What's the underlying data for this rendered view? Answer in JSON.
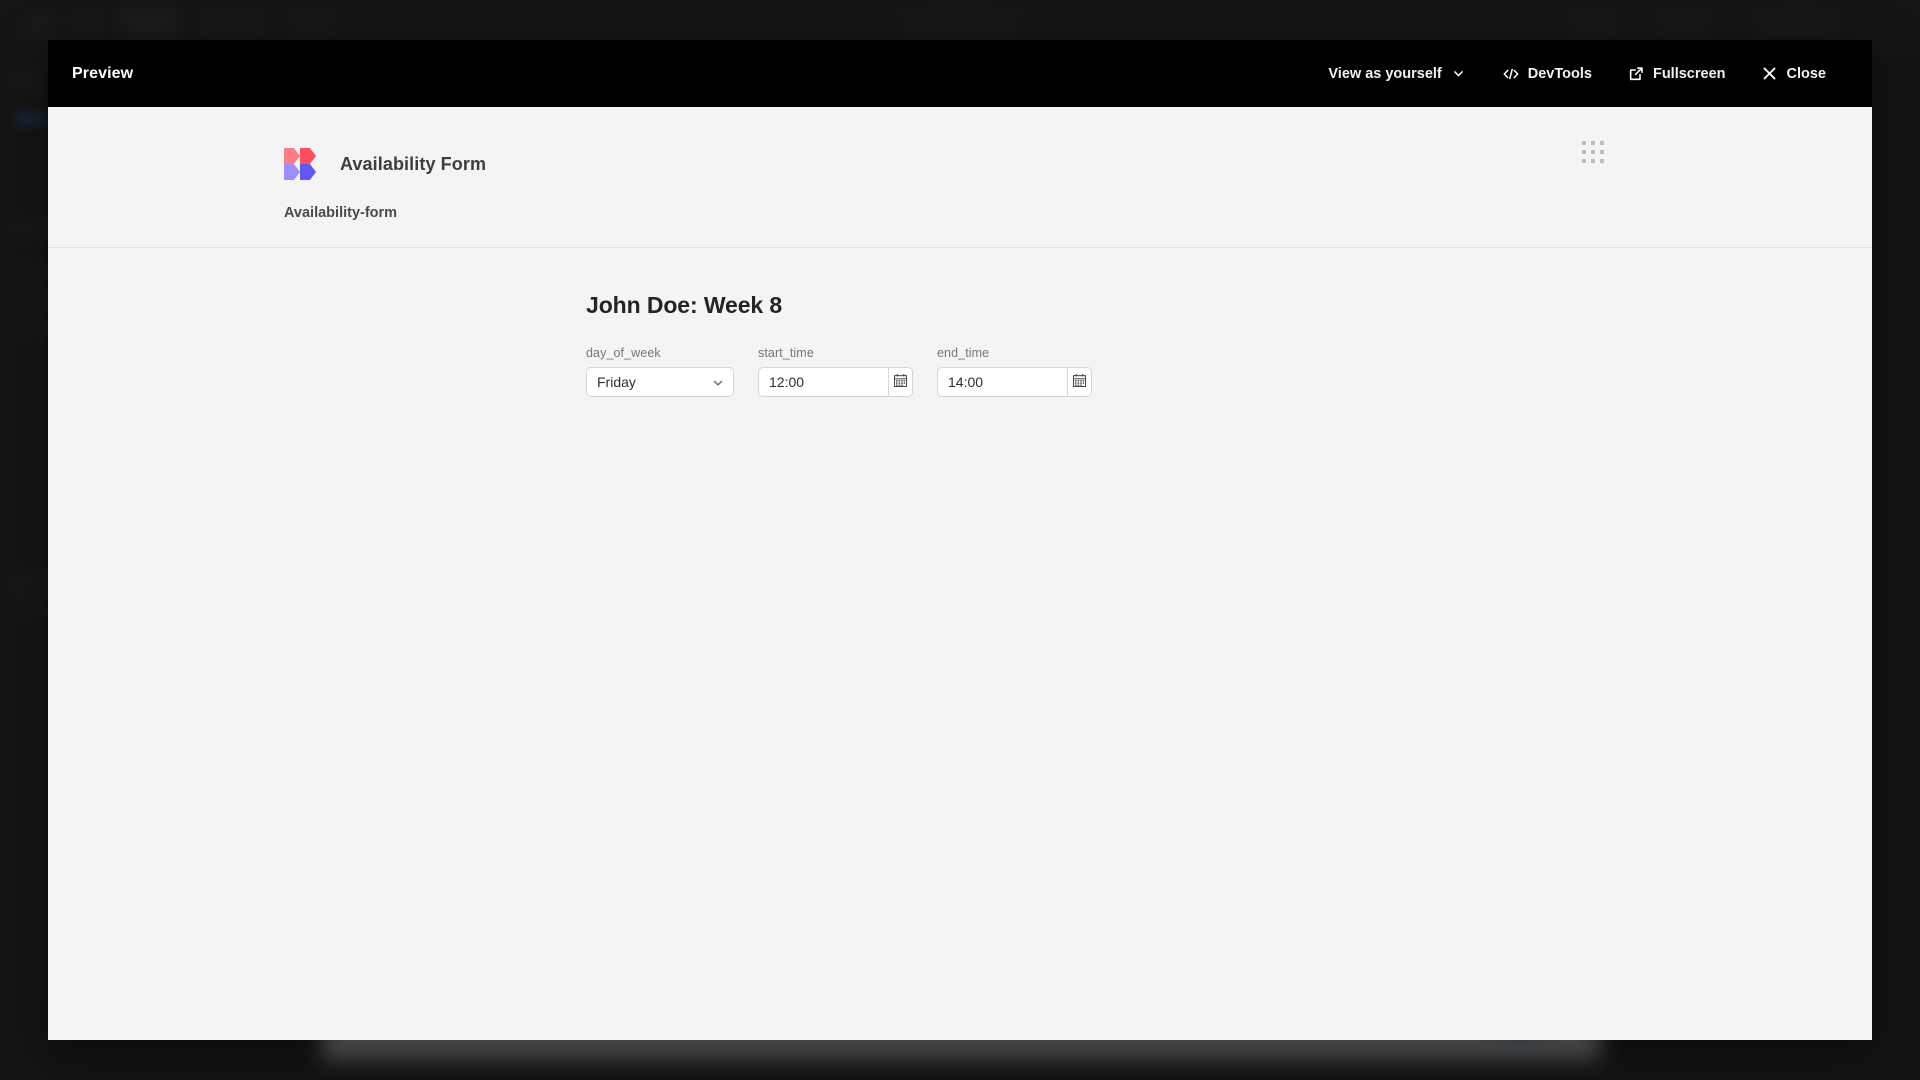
{
  "preview_modal": {
    "title": "Preview",
    "toolbar": [
      {
        "label": "View as yourself",
        "icon": "chevron-down-icon"
      },
      {
        "label": "DevTools",
        "icon": "code-brackets-icon"
      },
      {
        "label": "Fullscreen",
        "icon": "external-link-icon"
      },
      {
        "label": "Close",
        "icon": "close-icon"
      }
    ]
  },
  "app": {
    "name": "Availability Form",
    "logo_colors": {
      "top_left": "#fa7d85",
      "top_right": "#fd4f5e",
      "bottom_left": "#9e8dfb",
      "bottom_right": "#6357f4"
    },
    "grid_menu_icon": "apps-grid-icon",
    "breadcrumb": "Availability-form"
  },
  "form": {
    "heading": "John Doe: Week 8",
    "fields": [
      {
        "label": "day_of_week",
        "type": "select",
        "value": "Friday",
        "icon": "chevron-down-icon"
      },
      {
        "label": "start_time",
        "type": "time",
        "value": "12:00",
        "placeholder": "hh:mm",
        "icon": "calendar-icon"
      },
      {
        "label": "end_time",
        "type": "time",
        "value": "14:00",
        "placeholder": "hh:mm",
        "icon": "calendar-icon"
      }
    ]
  },
  "theme": {
    "toolbar_bg": "#000000",
    "page_bg": "#f4f4f5",
    "accent_red": "#fd4f5e",
    "accent_purple": "#6357f4",
    "text_primary": "#242424",
    "text_muted": "#767679"
  }
}
